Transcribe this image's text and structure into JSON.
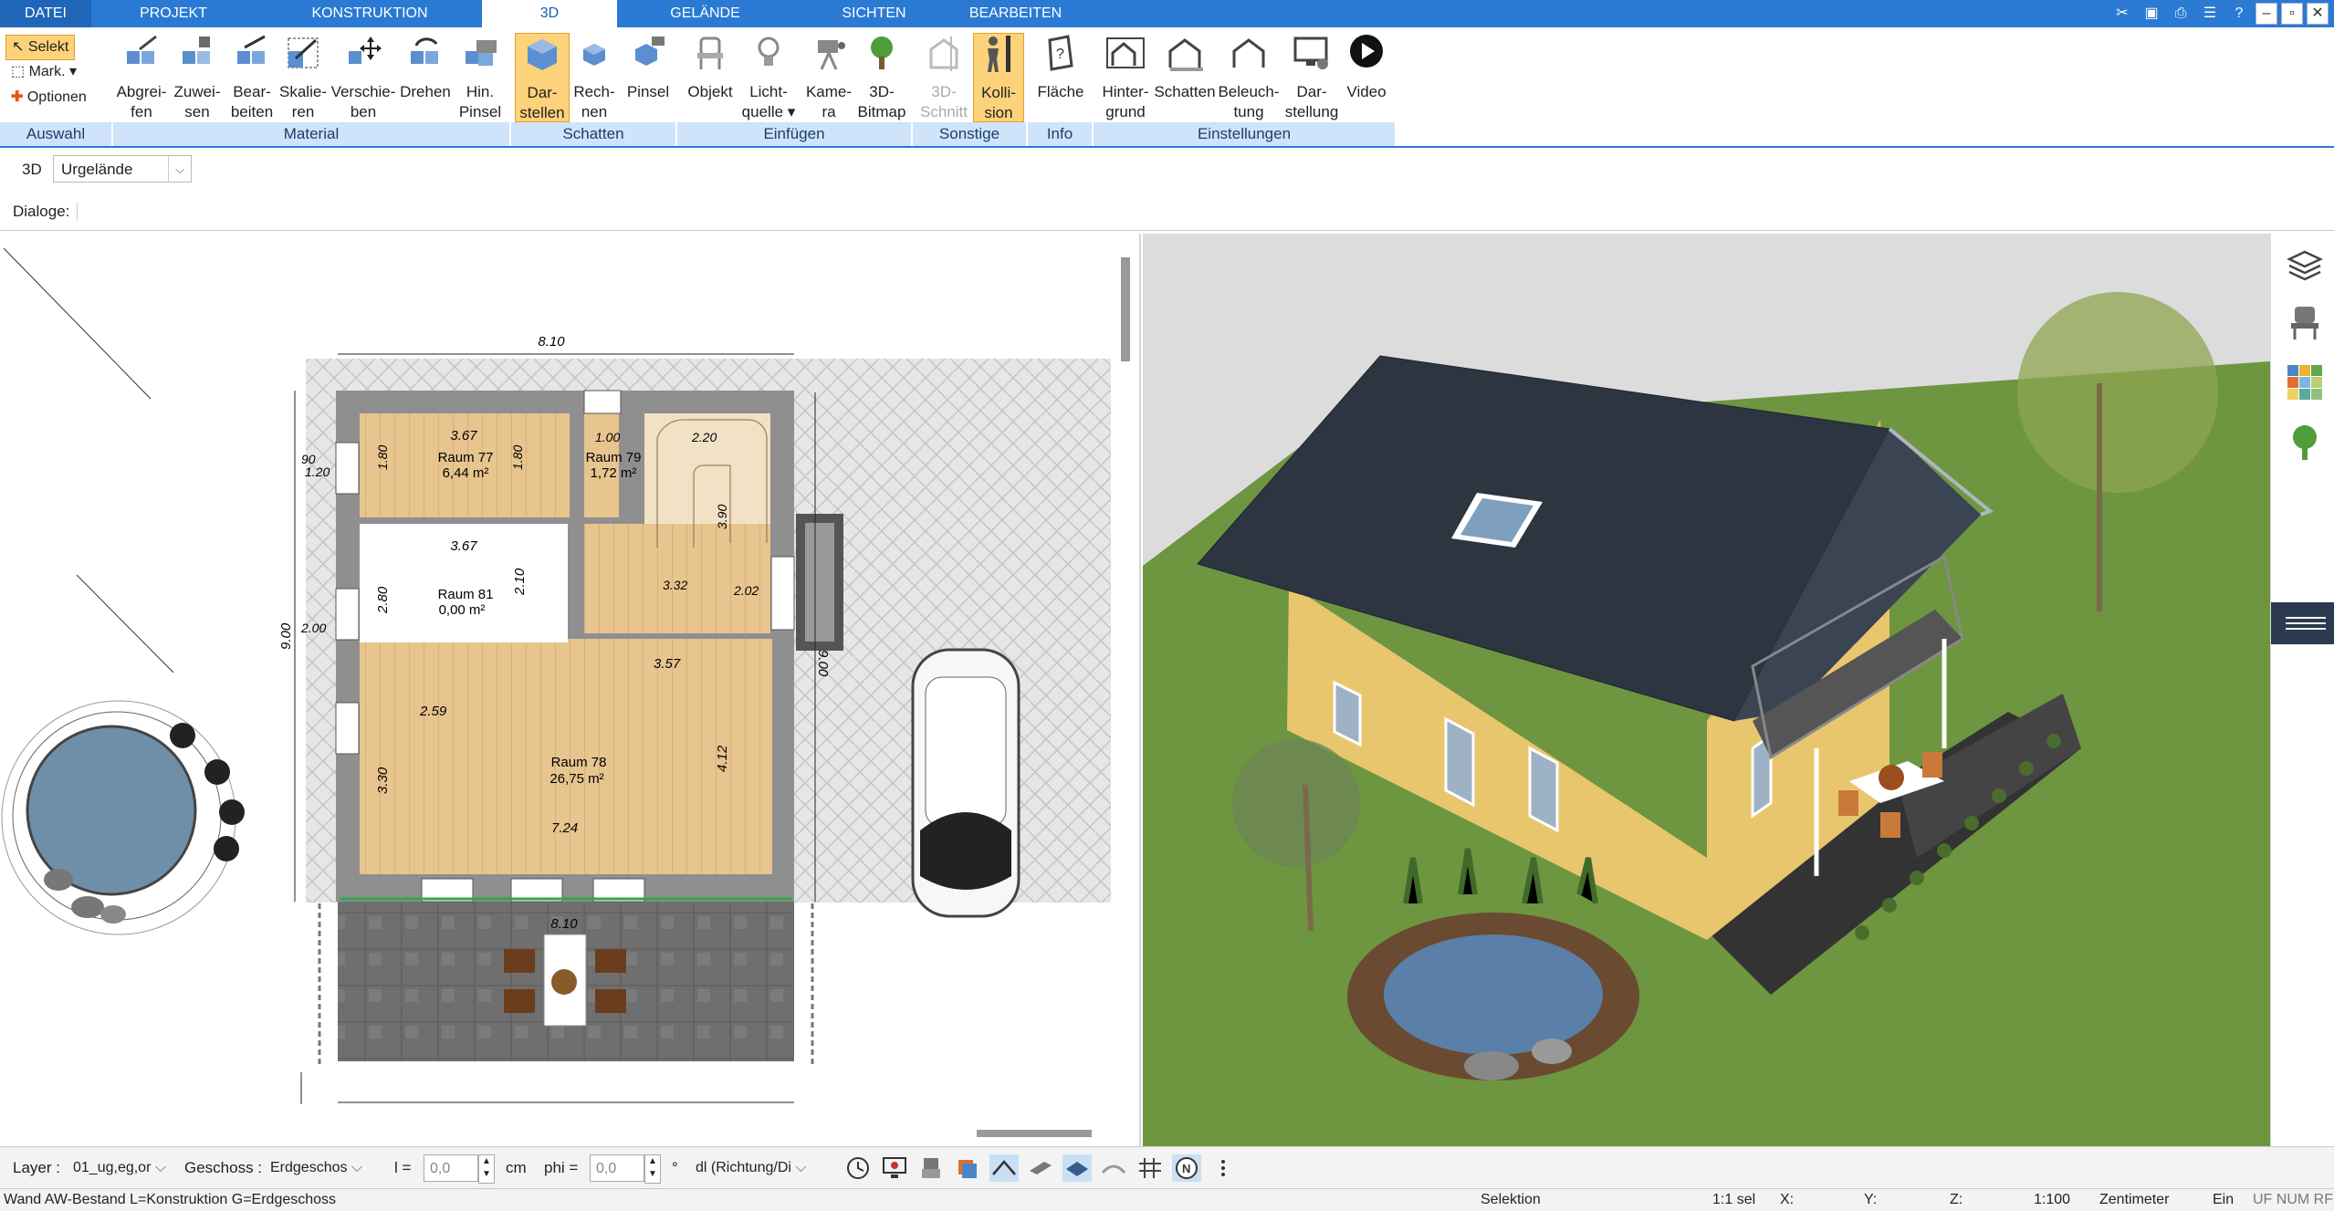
{
  "menu": {
    "tabs": [
      "DATEI",
      "PROJEKT",
      "KONSTRUKTION",
      "3D",
      "GELÄNDE",
      "SICHTEN",
      "BEARBEITEN"
    ],
    "active": "3D"
  },
  "ribbon": {
    "auswahl": {
      "select": "Selekt",
      "mark": "Mark.",
      "options": "Optionen",
      "group": "Auswahl"
    },
    "material": {
      "group": "Material",
      "buttons": [
        [
          "Abgrei-",
          "fen"
        ],
        [
          "Zuwei-",
          "sen"
        ],
        [
          "Bear-",
          "beiten"
        ],
        [
          "Skalie-",
          "ren"
        ],
        [
          "Verschie-",
          "ben"
        ],
        [
          "Drehen",
          ""
        ],
        [
          "Hin.",
          "Pinsel"
        ]
      ]
    },
    "schatten": {
      "group": "Schatten",
      "buttons": [
        [
          "Dar-",
          "stellen"
        ],
        [
          "Rech-",
          "nen"
        ],
        [
          "Pinsel",
          ""
        ]
      ]
    },
    "einfuegen": {
      "group": "Einfügen",
      "buttons": [
        [
          "Objekt",
          ""
        ],
        [
          "Licht-",
          "quelle"
        ],
        [
          "Kame-",
          "ra"
        ],
        [
          "3D-",
          "Bitmap"
        ]
      ]
    },
    "sonstige": {
      "group": "Sonstige",
      "buttons": [
        [
          "3D-",
          "Schnitt"
        ],
        [
          "Kolli-",
          "sion"
        ]
      ]
    },
    "info": {
      "group": "Info",
      "buttons": [
        [
          "Fläche",
          ""
        ]
      ]
    },
    "einstellungen": {
      "group": "Einstellungen",
      "buttons": [
        [
          "Hinter-",
          "grund"
        ],
        [
          "Schatten",
          ""
        ],
        [
          "Beleuch-",
          "tung"
        ],
        [
          "Dar-",
          "stellung"
        ],
        [
          "Video",
          ""
        ]
      ]
    }
  },
  "row2": {
    "mode": "3D",
    "terrain": "Urgelände"
  },
  "row3": {
    "dialogs": "Dialoge:"
  },
  "plan": {
    "dims": {
      "top": "8.10",
      "left": "9.00",
      "right": "9.00",
      "bottom": "8.10",
      "d367a": "3.67",
      "d367b": "3.67",
      "d180a": "1.80",
      "d180b": "1.80",
      "d280": "2.80",
      "d210": "2.10",
      "d259": "2.59",
      "d357": "3.57",
      "d412": "4.12",
      "d330": "3.30",
      "d724": "7.24",
      "d100": "1.00",
      "d220": "2.20",
      "d390": "3.90",
      "d202": "2.02",
      "d332": "3.32",
      "d90a": "90",
      "d120a": "1.20",
      "d200": "2.00"
    },
    "rooms": [
      {
        "name": "Raum 77",
        "area": "6,44 m²"
      },
      {
        "name": "Raum 79",
        "area": "1,72 m²"
      },
      {
        "name": "Raum 81",
        "area": "0,00 m²"
      },
      {
        "name": "Raum 78",
        "area": "26,75 m²"
      }
    ]
  },
  "bottombar": {
    "layer_label": "Layer :",
    "layer_value": "01_ug,eg,or",
    "floor_label": "Geschoss :",
    "floor_value": "Erdgeschos",
    "l_label": "l =",
    "l_value": "0,0",
    "l_unit": "cm",
    "phi_label": "phi =",
    "phi_value": "0,0",
    "phi_unit": "°",
    "dl_value": "dl (Richtung/Di"
  },
  "status": {
    "hint": "Wand AW-Bestand L=Konstruktion G=Erdgeschoss",
    "mode": "Selektion",
    "sel": "1:1 sel",
    "x": "X:",
    "y": "Y:",
    "z": "Z:",
    "scale": "1:100",
    "unit": "Zentimeter",
    "ein": "Ein",
    "flags": "UF NUM RF"
  },
  "colors": {
    "accent": "#2a7ad4",
    "ribbon_group": "#cfe3fa",
    "selected": "#fcd27a",
    "grass": "#6a8f3c",
    "wall": "#e8c66e",
    "roof": "#2d3541"
  }
}
